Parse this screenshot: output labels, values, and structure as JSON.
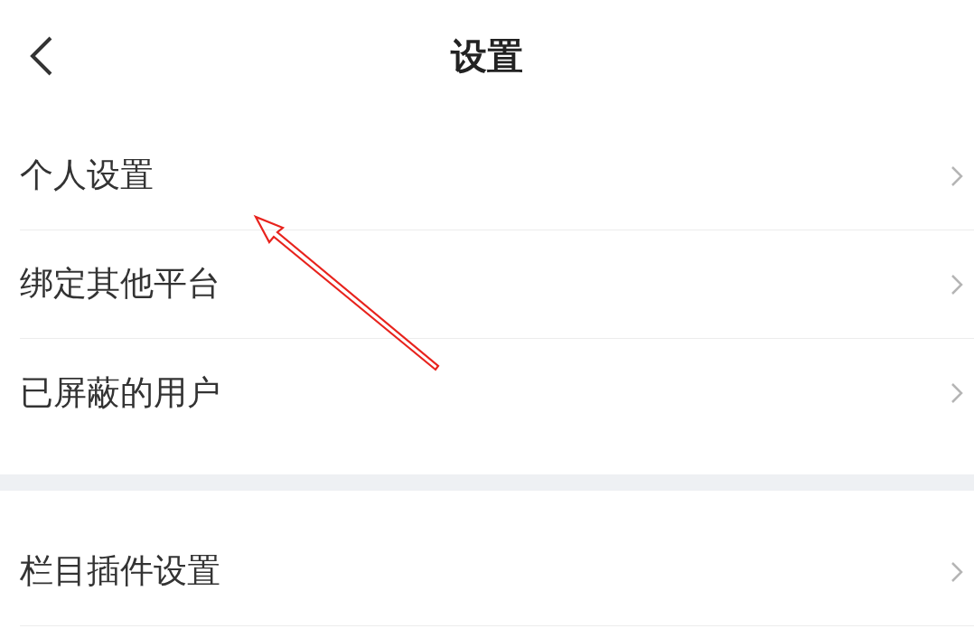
{
  "header": {
    "title": "设置"
  },
  "sections": [
    {
      "items": [
        {
          "label": "个人设置"
        },
        {
          "label": "绑定其他平台"
        },
        {
          "label": "已屏蔽的用户"
        }
      ]
    },
    {
      "items": [
        {
          "label": "栏目插件设置"
        }
      ]
    }
  ],
  "annotations": [
    {
      "kind": "arrow"
    }
  ]
}
